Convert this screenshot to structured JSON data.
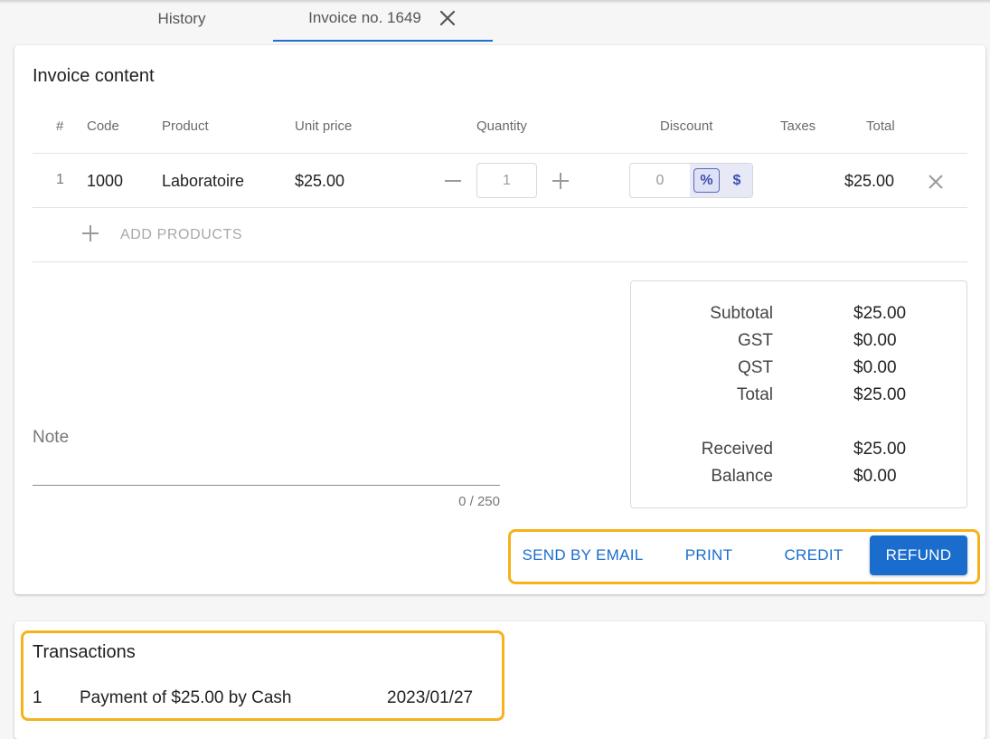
{
  "tabs": {
    "history": "History",
    "invoice": "Invoice no. 1649"
  },
  "invoice": {
    "title": "Invoice content",
    "columns": {
      "num": "#",
      "code": "Code",
      "product": "Product",
      "unit_price": "Unit price",
      "quantity": "Quantity",
      "discount": "Discount",
      "taxes": "Taxes",
      "total": "Total"
    },
    "items": [
      {
        "index": "1",
        "code": "1000",
        "product": "Laboratoire",
        "unit_price": "$25.00",
        "quantity": "1",
        "discount": "0",
        "discount_percent": "%",
        "discount_dollar": "$",
        "total": "$25.00"
      }
    ],
    "add_products": "ADD PRODUCTS"
  },
  "note": {
    "label": "Note",
    "counter": "0 / 250"
  },
  "summary": {
    "subtotal_label": "Subtotal",
    "subtotal": "$25.00",
    "gst_label": "GST",
    "gst": "$0.00",
    "qst_label": "QST",
    "qst": "$0.00",
    "total_label": "Total",
    "total": "$25.00",
    "received_label": "Received",
    "received": "$25.00",
    "balance_label": "Balance",
    "balance": "$0.00"
  },
  "actions": {
    "send_email": "SEND BY EMAIL",
    "print": "PRINT",
    "credit": "CREDIT",
    "refund": "REFUND"
  },
  "transactions": {
    "title": "Transactions",
    "items": [
      {
        "index": "1",
        "description": "Payment of $25.00 by Cash",
        "date": "2023/01/27"
      }
    ]
  },
  "colors": {
    "accent": "#1a6dcd",
    "highlight": "#f6b21c",
    "discount_unit_bg": "#e7e9f7"
  }
}
